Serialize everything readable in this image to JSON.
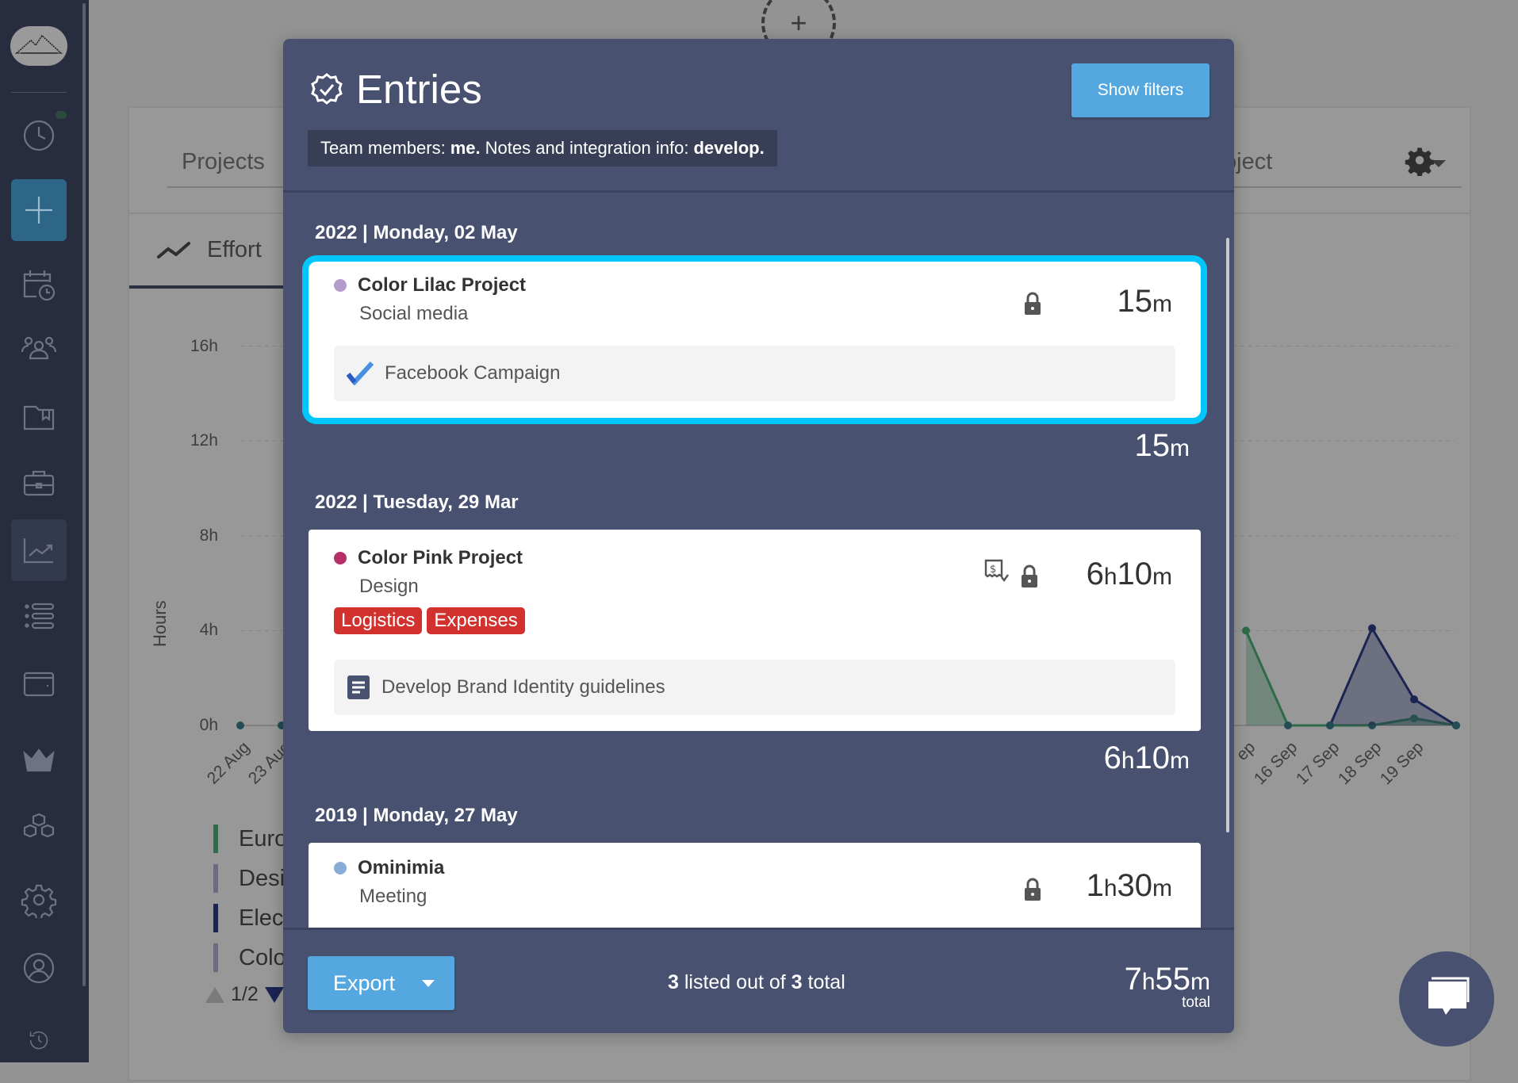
{
  "sidebar": {
    "items": [
      {
        "name": "timer",
        "icon": "clock-icon"
      },
      {
        "name": "add",
        "icon": "plus-icon"
      },
      {
        "name": "calendar",
        "icon": "calendar-clock-icon"
      },
      {
        "name": "team",
        "icon": "people-icon"
      },
      {
        "name": "projects",
        "icon": "book-icon"
      },
      {
        "name": "clients",
        "icon": "briefcase-icon"
      },
      {
        "name": "reports",
        "icon": "chart-icon"
      },
      {
        "name": "entries",
        "icon": "list-icon"
      },
      {
        "name": "billing",
        "icon": "wallet-icon"
      },
      {
        "name": "premium",
        "icon": "crown-icon"
      },
      {
        "name": "integrations",
        "icon": "cubes-icon"
      },
      {
        "name": "settings",
        "icon": "gear-icon"
      },
      {
        "name": "account",
        "icon": "user-circle-icon"
      },
      {
        "name": "history",
        "icon": "history-icon"
      }
    ],
    "active": "reports"
  },
  "background": {
    "projects_tab": "Projects",
    "project_select": "oject",
    "effort_tab": "Effort",
    "add_symbol": "+",
    "chart": {
      "ylabel": "Hours",
      "yticks": [
        "16h",
        "12h",
        "8h",
        "4h",
        "0h"
      ],
      "xticks_left": [
        "22 Aug",
        "23 Aug"
      ],
      "xticks_right": [
        "ep",
        "16 Sep",
        "17 Sep",
        "18 Sep",
        "19 Sep"
      ],
      "series_right": [
        {
          "color": "#2f6b48",
          "values": [
            4,
            0,
            0,
            0,
            0.3,
            0
          ]
        },
        {
          "color": "#1c2452",
          "values": [
            null,
            null,
            0,
            4.1,
            1.1,
            0
          ]
        }
      ],
      "legend": [
        {
          "label": "Euro",
          "color": "#2f6b48"
        },
        {
          "label": "Desi",
          "color": "#6e6880"
        },
        {
          "label": "Elect",
          "color": "#1c2452"
        },
        {
          "label": "Colo",
          "color": "#6e6880"
        }
      ],
      "legend_page": "1/2"
    }
  },
  "modal": {
    "title": "Entries",
    "show_filters": "Show filters",
    "team_info": {
      "prefix": "Team members:",
      "members": "me.",
      "notes_prefix": "Notes and integration info:",
      "notes": "develop."
    },
    "groups": [
      {
        "date": "2022 | Monday, 02 May",
        "subtotal": {
          "h": "",
          "m": "15"
        },
        "entries": [
          {
            "project": "Color Lilac Project",
            "color": "#b39ccb",
            "task": "Social media",
            "duration": {
              "h": "",
              "m": "15"
            },
            "note": "Facebook Campaign",
            "note_icon": "check-icon",
            "locked": true,
            "selected": true
          }
        ]
      },
      {
        "date": "2022 | Tuesday, 29 Mar",
        "subtotal": {
          "h": "6",
          "m": "10"
        },
        "entries": [
          {
            "project": "Color Pink Project",
            "color": "#b3306a",
            "task": "Design",
            "duration": {
              "h": "6",
              "m": "10"
            },
            "tags": [
              "Logistics",
              "Expenses"
            ],
            "note": "Develop Brand Identity guidelines",
            "note_icon": "document-icon",
            "locked": true,
            "billable_icon": "receipt-dollar-icon"
          }
        ]
      },
      {
        "date": "2019 | Monday, 27 May",
        "entries": [
          {
            "project": "Ominimia",
            "color": "#88acd6",
            "task": "Meeting",
            "duration": {
              "h": "1",
              "m": "30"
            },
            "locked": true
          }
        ]
      }
    ],
    "footer": {
      "export": "Export",
      "listed": "3",
      "listed_text": " listed out of ",
      "total_count": "3",
      "total_text": " total",
      "total_duration": {
        "h": "7",
        "m": "55"
      },
      "total_label": "total"
    }
  },
  "units": {
    "h": "h",
    "m": "m"
  },
  "colors": {
    "accent": "#54a8df",
    "modal": "#48516f",
    "selected": "#00c6fb",
    "tag": "#d1322e"
  }
}
